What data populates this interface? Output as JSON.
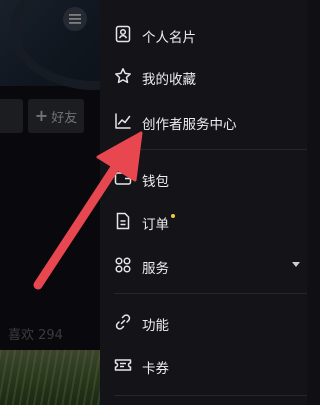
{
  "profile": {
    "add_friend_label": "好友",
    "likes_label": "喜欢 294"
  },
  "drawer": {
    "items": [
      {
        "label": "个人名片",
        "icon": "contact-card-icon"
      },
      {
        "label": "我的收藏",
        "icon": "star-icon"
      },
      {
        "label": "创作者服务中心",
        "icon": "analytics-chart-icon"
      },
      {
        "label": "钱包",
        "icon": "wallet-icon"
      },
      {
        "label": "订单",
        "icon": "order-document-icon",
        "has_notification_dot": true
      },
      {
        "label": "服务",
        "icon": "services-grid-icon",
        "expandable": true
      },
      {
        "label": "功能",
        "icon": "link-icon"
      },
      {
        "label": "卡券",
        "icon": "coupon-ticket-icon"
      }
    ]
  },
  "annotation": {
    "arrow_color": "#e8474f",
    "points_to": "创作者服务中心"
  }
}
